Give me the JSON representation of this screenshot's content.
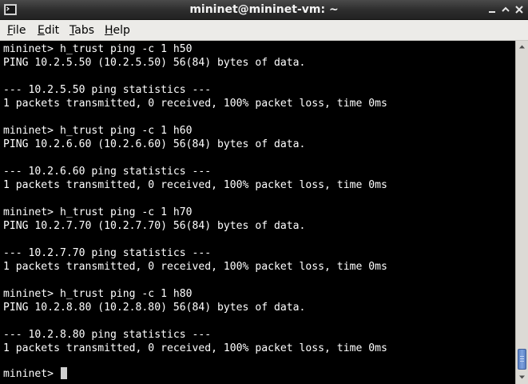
{
  "window": {
    "title": "mininet@mininet-vm: ~"
  },
  "menu": {
    "file": {
      "mnemonic": "F",
      "rest": "ile"
    },
    "edit": {
      "mnemonic": "E",
      "rest": "dit"
    },
    "tabs": {
      "mnemonic": "T",
      "rest": "abs"
    },
    "help": {
      "mnemonic": "H",
      "rest": "elp"
    }
  },
  "terminal": {
    "lines": [
      "mininet> h_trust ping -c 1 h50",
      "PING 10.2.5.50 (10.2.5.50) 56(84) bytes of data.",
      "",
      "--- 10.2.5.50 ping statistics ---",
      "1 packets transmitted, 0 received, 100% packet loss, time 0ms",
      "",
      "mininet> h_trust ping -c 1 h60",
      "PING 10.2.6.60 (10.2.6.60) 56(84) bytes of data.",
      "",
      "--- 10.2.6.60 ping statistics ---",
      "1 packets transmitted, 0 received, 100% packet loss, time 0ms",
      "",
      "mininet> h_trust ping -c 1 h70",
      "PING 10.2.7.70 (10.2.7.70) 56(84) bytes of data.",
      "",
      "--- 10.2.7.70 ping statistics ---",
      "1 packets transmitted, 0 received, 100% packet loss, time 0ms",
      "",
      "mininet> h_trust ping -c 1 h80",
      "PING 10.2.8.80 (10.2.8.80) 56(84) bytes of data.",
      "",
      "--- 10.2.8.80 ping statistics ---",
      "1 packets transmitted, 0 received, 100% packet loss, time 0ms"
    ],
    "prompt": "mininet> ",
    "text_color": "#ffffff",
    "background_color": "#000000"
  },
  "scrollbar": {
    "position_fraction": 1.0
  },
  "icons": {
    "window_menu": "terminal-window-icon",
    "minimize": "minimize-icon",
    "maximize": "maximize-icon",
    "close": "close-icon",
    "scroll_up": "arrow-up-icon",
    "scroll_down": "arrow-down-icon"
  }
}
